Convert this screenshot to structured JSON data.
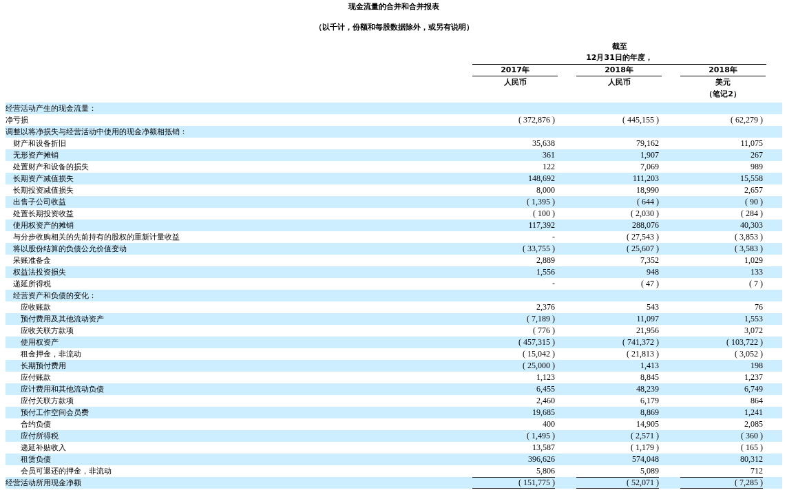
{
  "title": "现金流量的合并和合并报表",
  "subtitle": "（以千计，份额和每股数据除外，或另有说明）",
  "period_header": [
    "截至",
    "12月31日的年度，"
  ],
  "columns": [
    {
      "year": "2017年",
      "currency": "人民币"
    },
    {
      "year": "2018年",
      "currency": "人民币"
    },
    {
      "year": "2018年",
      "currency": "美元",
      "note": "（笔记2）"
    }
  ],
  "rows": [
    {
      "kind": "heading",
      "label": "经营活动产生的现金流量："
    },
    {
      "kind": "line",
      "label": "净亏损",
      "values": [
        "( 372,876 )",
        "( 445,155 )",
        "( 62,279 )"
      ]
    },
    {
      "kind": "heading",
      "label": "调整以将净损失与经营活动中使用的现金净额相抵销：",
      "children": [
        {
          "kind": "line",
          "label": "财产和设备折旧",
          "values": [
            "35,638",
            "79,162",
            "11,075"
          ]
        },
        {
          "kind": "line",
          "label": "无形资产摊销",
          "values": [
            "361",
            "1,907",
            "267"
          ]
        },
        {
          "kind": "line",
          "label": "处置财产和设备的损失",
          "values": [
            "122",
            "7,069",
            "989"
          ]
        },
        {
          "kind": "line",
          "label": "长期资产减值损失",
          "values": [
            "148,692",
            "111,203",
            "15,558"
          ]
        },
        {
          "kind": "line",
          "label": "长期投资减值损失",
          "values": [
            "8,000",
            "18,990",
            "2,657"
          ]
        },
        {
          "kind": "line",
          "label": "出售子公司收益",
          "values": [
            "( 1,395 )",
            "( 644 )",
            "( 90 )"
          ]
        },
        {
          "kind": "line",
          "label": "处置长期投资收益",
          "values": [
            "( 100 )",
            "( 2,030 )",
            "( 284 )"
          ]
        },
        {
          "kind": "line",
          "label": "使用权资产的摊销",
          "values": [
            "117,392",
            "288,076",
            "40,303"
          ]
        },
        {
          "kind": "line",
          "label": "与分步收购相关的先前持有的股权的重新计量收益",
          "values": [
            "-",
            "( 27,543 )",
            "( 3,853 )"
          ]
        },
        {
          "kind": "line",
          "label": "将以股份结算的负债公允价值变动",
          "values": [
            "( 33,755 )",
            "( 25,607 )",
            "( 3,583 )"
          ]
        },
        {
          "kind": "line",
          "label": "呆账准备金",
          "values": [
            "2,889",
            "7,352",
            "1,029"
          ]
        },
        {
          "kind": "line",
          "label": "权益法投资损失",
          "values": [
            "1,556",
            "948",
            "133"
          ]
        },
        {
          "kind": "line",
          "label": "递延所得税",
          "values": [
            "-",
            "( 47 )",
            "( 7 )"
          ]
        },
        {
          "kind": "heading",
          "label": "经营资产和负债的变化：",
          "children": [
            {
              "kind": "line",
              "label": "应收账款",
              "values": [
                "2,376",
                "543",
                "76"
              ]
            },
            {
              "kind": "line",
              "label": "预付费用及其他流动资产",
              "values": [
                "( 7,189 )",
                "11,097",
                "1,553"
              ]
            },
            {
              "kind": "line",
              "label": "应收关联方款项",
              "values": [
                "( 776 )",
                "21,956",
                "3,072"
              ]
            },
            {
              "kind": "line",
              "label": "使用权资产",
              "values": [
                "( 457,315 )",
                "( 741,372 )",
                "( 103,722 )"
              ]
            },
            {
              "kind": "line",
              "label": "租金押金，非流动",
              "values": [
                "( 15,042 )",
                "( 21,813 )",
                "( 3,052 )"
              ]
            },
            {
              "kind": "line",
              "label": "长期预付费用",
              "values": [
                "( 25,000 )",
                "1,413",
                "198"
              ]
            },
            {
              "kind": "line",
              "label": "应付账款",
              "values": [
                "1,123",
                "8,845",
                "1,237"
              ]
            },
            {
              "kind": "line",
              "label": "应计费用和其他流动负债",
              "values": [
                "6,455",
                "48,239",
                "6,749"
              ]
            },
            {
              "kind": "line",
              "label": "应付关联方款项",
              "values": [
                "2,460",
                "6,179",
                "864"
              ]
            },
            {
              "kind": "line",
              "label": "预付工作空间会员费",
              "values": [
                "19,685",
                "8,869",
                "1,241"
              ]
            },
            {
              "kind": "line",
              "label": "合约负债",
              "values": [
                "400",
                "14,905",
                "2,085"
              ]
            },
            {
              "kind": "line",
              "label": "应付所得税",
              "values": [
                "( 1,495 )",
                "( 2,571 )",
                "( 360 )"
              ]
            },
            {
              "kind": "line",
              "label": "递延补贴收入",
              "values": [
                "13,587",
                "( 1,179 )",
                "( 165 )"
              ]
            },
            {
              "kind": "line",
              "label": "租赁负债",
              "values": [
                "396,626",
                "574,048",
                "80,312"
              ]
            },
            {
              "kind": "line",
              "label": "会员可退还的押金，非流动",
              "values": [
                "5,806",
                "5,089",
                "712"
              ]
            }
          ]
        }
      ]
    },
    {
      "kind": "total",
      "label": "经营活动所用现金净额",
      "values": [
        "( 151,775 )",
        "( 52,071 )",
        "( 7,285 )"
      ]
    }
  ]
}
